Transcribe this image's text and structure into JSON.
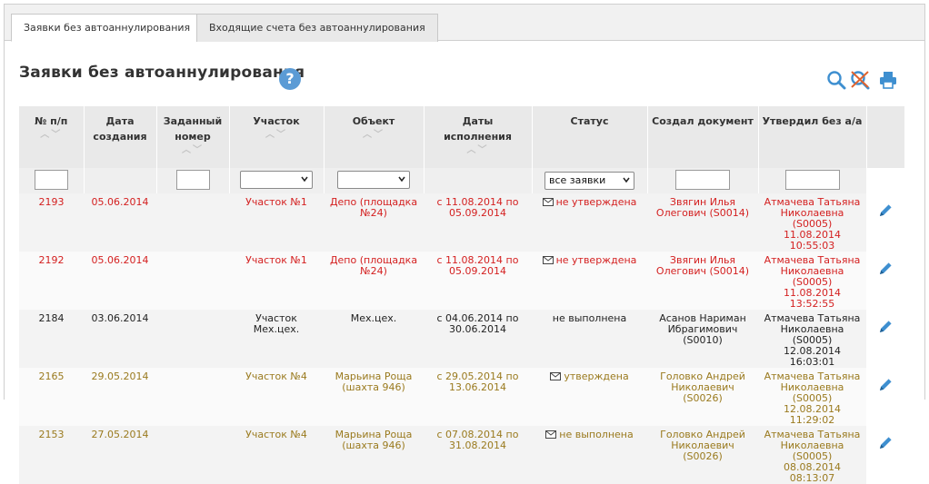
{
  "tabs": [
    {
      "label": "Заявки без автоаннулирования",
      "active": true
    },
    {
      "label": "Входящие счета без автоаннулирования",
      "active": false
    }
  ],
  "page": {
    "title": "Заявки без автоаннулирования",
    "help": "?"
  },
  "toolbar": {
    "icons": [
      "search-icon",
      "clear-search-icon",
      "print-icon"
    ]
  },
  "colors": {
    "red": "#d42020",
    "olive": "#9a7a1e",
    "accent": "#5b9bd5"
  },
  "columns": [
    {
      "label": "№ п/п",
      "sortable": true
    },
    {
      "label": "Дата создания",
      "sortable": false
    },
    {
      "label": "Заданный номер",
      "sortable": true
    },
    {
      "label": "Участок",
      "sortable": true
    },
    {
      "label": "Объект",
      "sortable": true
    },
    {
      "label": "Даты исполнения",
      "sortable": true
    },
    {
      "label": "Статус",
      "sortable": false
    },
    {
      "label": "Создал документ",
      "sortable": false
    },
    {
      "label": "Утвердил без а/а",
      "sortable": false
    }
  ],
  "filters": {
    "num": "",
    "assigned": "",
    "area": "",
    "object": "",
    "status": "все заявки",
    "creator": "",
    "approver": ""
  },
  "rows": [
    {
      "num": "2193",
      "created": "05.06.2014",
      "assigned": "",
      "area": "Участок №1",
      "object": "Депо (площадка №24)",
      "dates": "с 11.08.2014 по 05.09.2014",
      "status": "не утверждена",
      "envelope": true,
      "creator": "Звягин Илья Олегович (S0014)",
      "approver": "Атмачева Татьяна Николаевна (S0005)",
      "approved_at": "11.08.2014 10:55:03",
      "tone": "red"
    },
    {
      "num": "2192",
      "created": "05.06.2014",
      "assigned": "",
      "area": "Участок №1",
      "object": "Депо (площадка №24)",
      "dates": "с 11.08.2014 по 05.09.2014",
      "status": "не утверждена",
      "envelope": true,
      "creator": "Звягин Илья Олегович (S0014)",
      "approver": "Атмачева Татьяна Николаевна (S0005)",
      "approved_at": "11.08.2014 13:52:55",
      "tone": "red"
    },
    {
      "num": "2184",
      "created": "03.06.2014",
      "assigned": "",
      "area": "Участок Мех.цех.",
      "object": "Мех.цех.",
      "dates": "с 04.06.2014 по 30.06.2014",
      "status": "не выполнена",
      "envelope": false,
      "creator": "Асанов Нариман Ибрагимович (S0010)",
      "approver": "Атмачева Татьяна Николаевна (S0005)",
      "approved_at": "12.08.2014 16:03:01",
      "tone": "black"
    },
    {
      "num": "2165",
      "created": "29.05.2014",
      "assigned": "",
      "area": "Участок №4",
      "object": "Марьина Роща (шахта 946)",
      "dates": "с 29.05.2014 по 13.06.2014",
      "status": "утверждена",
      "envelope": true,
      "creator": "Головко Андрей Николаевич (S0026)",
      "approver": "Атмачева Татьяна Николаевна (S0005)",
      "approved_at": "12.08.2014 11:29:02",
      "tone": "olive"
    },
    {
      "num": "2153",
      "created": "27.05.2014",
      "assigned": "",
      "area": "Участок №4",
      "object": "Марьина Роща (шахта 946)",
      "dates": "с 07.08.2014 по 31.08.2014",
      "status": "не выполнена",
      "envelope": true,
      "creator": "Головко Андрей Николаевич (S0026)",
      "approver": "Атмачева Татьяна Николаевна (S0005)",
      "approved_at": "08.08.2014 08:13:07",
      "tone": "olive"
    }
  ]
}
